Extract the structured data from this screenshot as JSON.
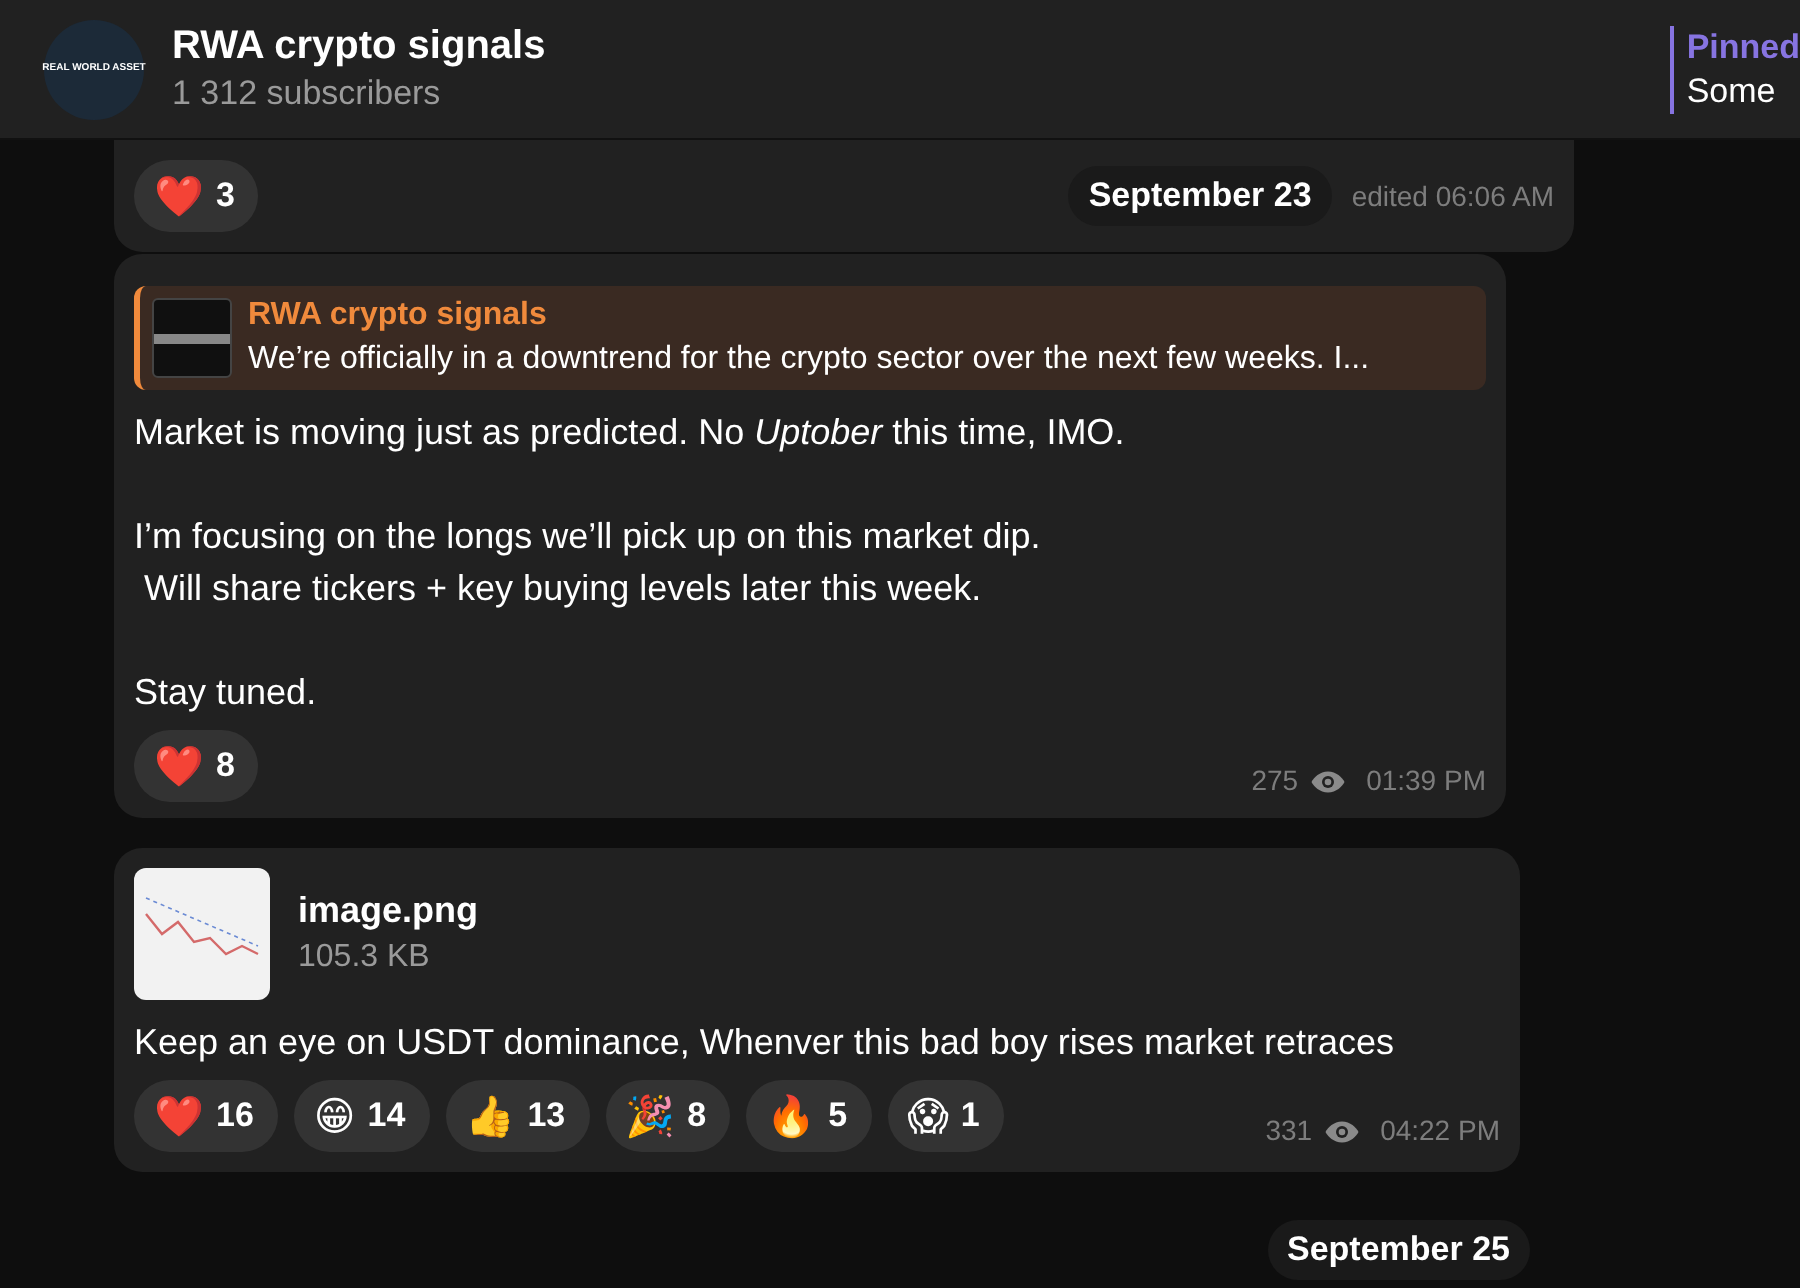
{
  "header": {
    "avatar_text": "REAL WORLD ASSET",
    "title": "RWA crypto signals",
    "subtitle": "1 312 subscribers",
    "pinned": {
      "label": "Pinned",
      "text": "Some"
    }
  },
  "messages": [
    {
      "kind": "tail",
      "reactions": [
        {
          "emoji": "❤️",
          "count": "3"
        }
      ],
      "edited": "edited 06:06 AM"
    },
    {
      "kind": "reply",
      "reply": {
        "author": "RWA crypto signals",
        "text": "We’re officially in a downtrend for the crypto sector over the next few weeks. I..."
      },
      "paragraphs": [
        "Market is moving just as predicted. No *Uptober* this time, IMO.",
        "I’m focusing on the longs we’ll pick up on this market dip.\n Will share tickers + key buying levels later this week.",
        "Stay tuned."
      ],
      "reactions": [
        {
          "emoji": "❤️",
          "count": "8"
        }
      ],
      "views": "275",
      "time": "01:39 PM"
    },
    {
      "kind": "file",
      "file": {
        "name": "image.png",
        "size": "105.3 KB"
      },
      "paragraphs": [
        "Keep an eye on USDT dominance, Whenver this bad boy rises market retraces"
      ],
      "reactions": [
        {
          "emoji": "❤️",
          "count": "16"
        },
        {
          "emoji": "😁",
          "count": "14"
        },
        {
          "emoji": "👍",
          "count": "13"
        },
        {
          "emoji": "🎉",
          "count": "8"
        },
        {
          "emoji": "🔥",
          "count": "5"
        },
        {
          "emoji": "😱",
          "count": "1"
        }
      ],
      "views": "331",
      "time": "04:22 PM"
    }
  ],
  "dates": [
    "September 23",
    "September 25"
  ]
}
